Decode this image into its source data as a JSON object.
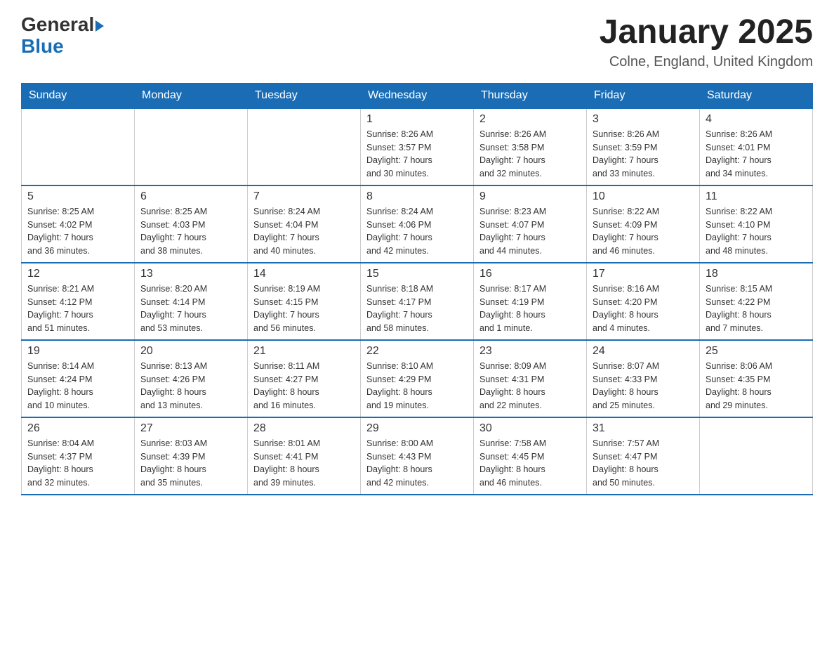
{
  "header": {
    "logo": {
      "general": "General",
      "blue": "Blue",
      "triangle": "▶"
    },
    "title": "January 2025",
    "location": "Colne, England, United Kingdom"
  },
  "weekdays": [
    "Sunday",
    "Monday",
    "Tuesday",
    "Wednesday",
    "Thursday",
    "Friday",
    "Saturday"
  ],
  "weeks": [
    [
      {
        "day": "",
        "info": ""
      },
      {
        "day": "",
        "info": ""
      },
      {
        "day": "",
        "info": ""
      },
      {
        "day": "1",
        "info": "Sunrise: 8:26 AM\nSunset: 3:57 PM\nDaylight: 7 hours\nand 30 minutes."
      },
      {
        "day": "2",
        "info": "Sunrise: 8:26 AM\nSunset: 3:58 PM\nDaylight: 7 hours\nand 32 minutes."
      },
      {
        "day": "3",
        "info": "Sunrise: 8:26 AM\nSunset: 3:59 PM\nDaylight: 7 hours\nand 33 minutes."
      },
      {
        "day": "4",
        "info": "Sunrise: 8:26 AM\nSunset: 4:01 PM\nDaylight: 7 hours\nand 34 minutes."
      }
    ],
    [
      {
        "day": "5",
        "info": "Sunrise: 8:25 AM\nSunset: 4:02 PM\nDaylight: 7 hours\nand 36 minutes."
      },
      {
        "day": "6",
        "info": "Sunrise: 8:25 AM\nSunset: 4:03 PM\nDaylight: 7 hours\nand 38 minutes."
      },
      {
        "day": "7",
        "info": "Sunrise: 8:24 AM\nSunset: 4:04 PM\nDaylight: 7 hours\nand 40 minutes."
      },
      {
        "day": "8",
        "info": "Sunrise: 8:24 AM\nSunset: 4:06 PM\nDaylight: 7 hours\nand 42 minutes."
      },
      {
        "day": "9",
        "info": "Sunrise: 8:23 AM\nSunset: 4:07 PM\nDaylight: 7 hours\nand 44 minutes."
      },
      {
        "day": "10",
        "info": "Sunrise: 8:22 AM\nSunset: 4:09 PM\nDaylight: 7 hours\nand 46 minutes."
      },
      {
        "day": "11",
        "info": "Sunrise: 8:22 AM\nSunset: 4:10 PM\nDaylight: 7 hours\nand 48 minutes."
      }
    ],
    [
      {
        "day": "12",
        "info": "Sunrise: 8:21 AM\nSunset: 4:12 PM\nDaylight: 7 hours\nand 51 minutes."
      },
      {
        "day": "13",
        "info": "Sunrise: 8:20 AM\nSunset: 4:14 PM\nDaylight: 7 hours\nand 53 minutes."
      },
      {
        "day": "14",
        "info": "Sunrise: 8:19 AM\nSunset: 4:15 PM\nDaylight: 7 hours\nand 56 minutes."
      },
      {
        "day": "15",
        "info": "Sunrise: 8:18 AM\nSunset: 4:17 PM\nDaylight: 7 hours\nand 58 minutes."
      },
      {
        "day": "16",
        "info": "Sunrise: 8:17 AM\nSunset: 4:19 PM\nDaylight: 8 hours\nand 1 minute."
      },
      {
        "day": "17",
        "info": "Sunrise: 8:16 AM\nSunset: 4:20 PM\nDaylight: 8 hours\nand 4 minutes."
      },
      {
        "day": "18",
        "info": "Sunrise: 8:15 AM\nSunset: 4:22 PM\nDaylight: 8 hours\nand 7 minutes."
      }
    ],
    [
      {
        "day": "19",
        "info": "Sunrise: 8:14 AM\nSunset: 4:24 PM\nDaylight: 8 hours\nand 10 minutes."
      },
      {
        "day": "20",
        "info": "Sunrise: 8:13 AM\nSunset: 4:26 PM\nDaylight: 8 hours\nand 13 minutes."
      },
      {
        "day": "21",
        "info": "Sunrise: 8:11 AM\nSunset: 4:27 PM\nDaylight: 8 hours\nand 16 minutes."
      },
      {
        "day": "22",
        "info": "Sunrise: 8:10 AM\nSunset: 4:29 PM\nDaylight: 8 hours\nand 19 minutes."
      },
      {
        "day": "23",
        "info": "Sunrise: 8:09 AM\nSunset: 4:31 PM\nDaylight: 8 hours\nand 22 minutes."
      },
      {
        "day": "24",
        "info": "Sunrise: 8:07 AM\nSunset: 4:33 PM\nDaylight: 8 hours\nand 25 minutes."
      },
      {
        "day": "25",
        "info": "Sunrise: 8:06 AM\nSunset: 4:35 PM\nDaylight: 8 hours\nand 29 minutes."
      }
    ],
    [
      {
        "day": "26",
        "info": "Sunrise: 8:04 AM\nSunset: 4:37 PM\nDaylight: 8 hours\nand 32 minutes."
      },
      {
        "day": "27",
        "info": "Sunrise: 8:03 AM\nSunset: 4:39 PM\nDaylight: 8 hours\nand 35 minutes."
      },
      {
        "day": "28",
        "info": "Sunrise: 8:01 AM\nSunset: 4:41 PM\nDaylight: 8 hours\nand 39 minutes."
      },
      {
        "day": "29",
        "info": "Sunrise: 8:00 AM\nSunset: 4:43 PM\nDaylight: 8 hours\nand 42 minutes."
      },
      {
        "day": "30",
        "info": "Sunrise: 7:58 AM\nSunset: 4:45 PM\nDaylight: 8 hours\nand 46 minutes."
      },
      {
        "day": "31",
        "info": "Sunrise: 7:57 AM\nSunset: 4:47 PM\nDaylight: 8 hours\nand 50 minutes."
      },
      {
        "day": "",
        "info": ""
      }
    ]
  ]
}
